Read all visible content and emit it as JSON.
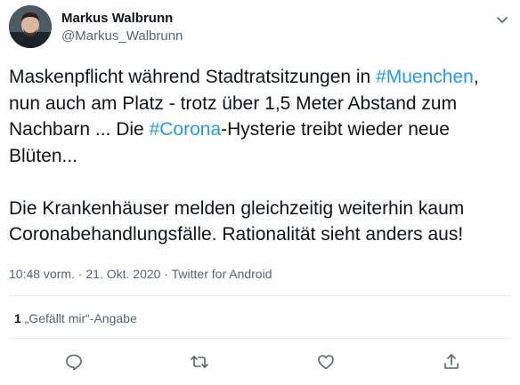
{
  "author": {
    "display_name": "Markus Walbrunn",
    "handle": "@Markus_Walbrunn"
  },
  "tweet": {
    "p1_seg1": "Maskenpflicht während Stadtratsitzungen in ",
    "hashtag1": "#Muenchen",
    "p1_seg2": ", nun auch am Platz - trotz über 1,5 Meter Abstand zum Nachbarn ... Die ",
    "hashtag2": "#Corona",
    "p1_seg3": "-Hysterie treibt wieder neue Blüten...",
    "p2": "Die Krankenhäuser melden gleichzeitig weiterhin kaum Coronabehandlungsfälle. Rationalität sieht anders aus!"
  },
  "meta": {
    "time": "10:48 vorm.",
    "date": "21. Okt. 2020",
    "sep": " · ",
    "source": "Twitter for Android"
  },
  "likes": {
    "count": "1",
    "label": " „Gefällt mir“-Angabe"
  },
  "colors": {
    "link": "#1d9bf0",
    "text": "#0f1419",
    "secondary": "#536471",
    "divider": "#e6ecf0"
  },
  "icons": {
    "menu": "chevron-down-icon",
    "reply": "reply-icon",
    "retweet": "retweet-icon",
    "like": "heart-icon",
    "share": "share-icon"
  }
}
